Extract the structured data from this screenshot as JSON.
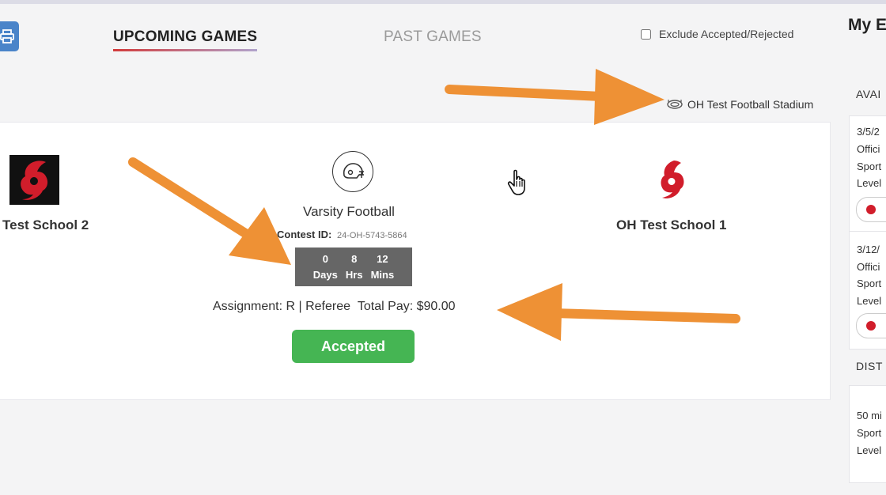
{
  "tabs": [
    {
      "label": "UPCOMING GAMES",
      "active": true
    },
    {
      "label": "PAST GAMES",
      "active": false
    }
  ],
  "filter": {
    "exclude_label": "Exclude Accepted/Rejected",
    "checked": false
  },
  "sidebar": {
    "title": "My E",
    "available_heading": "AVAI",
    "available_items": [
      {
        "date": "3/5/2",
        "line1": "Offici",
        "line2": "Sport",
        "line3": "Level"
      },
      {
        "date": "3/12/",
        "line1": "Offici",
        "line2": "Sport",
        "line3": "Level"
      }
    ],
    "distance_heading": "DIST",
    "distance_item": {
      "line1": "50 mi",
      "line2": "Sport",
      "line3": "Level"
    }
  },
  "game": {
    "venue": "OH Test Football Stadium",
    "away_team": "Test School 2",
    "home_team": "OH Test School 1",
    "sport": "Varsity Football",
    "contest_label": "Contest ID:",
    "contest_id": "24-OH-5743-5864",
    "countdown": [
      {
        "value": "0",
        "unit": "Days"
      },
      {
        "value": "8",
        "unit": "Hrs"
      },
      {
        "value": "12",
        "unit": "Mins"
      }
    ],
    "assignment": "Assignment: R | Referee",
    "total_pay": "Total Pay: $90.00",
    "status": "Accepted"
  },
  "colors": {
    "accent_blue": "#4a84c9",
    "accepted_green": "#45b553",
    "arrow_orange": "#ee9135",
    "logo_red": "#d11d2b"
  },
  "icons": [
    "print-icon",
    "stadium-icon",
    "football-helmet-icon",
    "hurricane-logo",
    "hand-cursor-icon"
  ]
}
